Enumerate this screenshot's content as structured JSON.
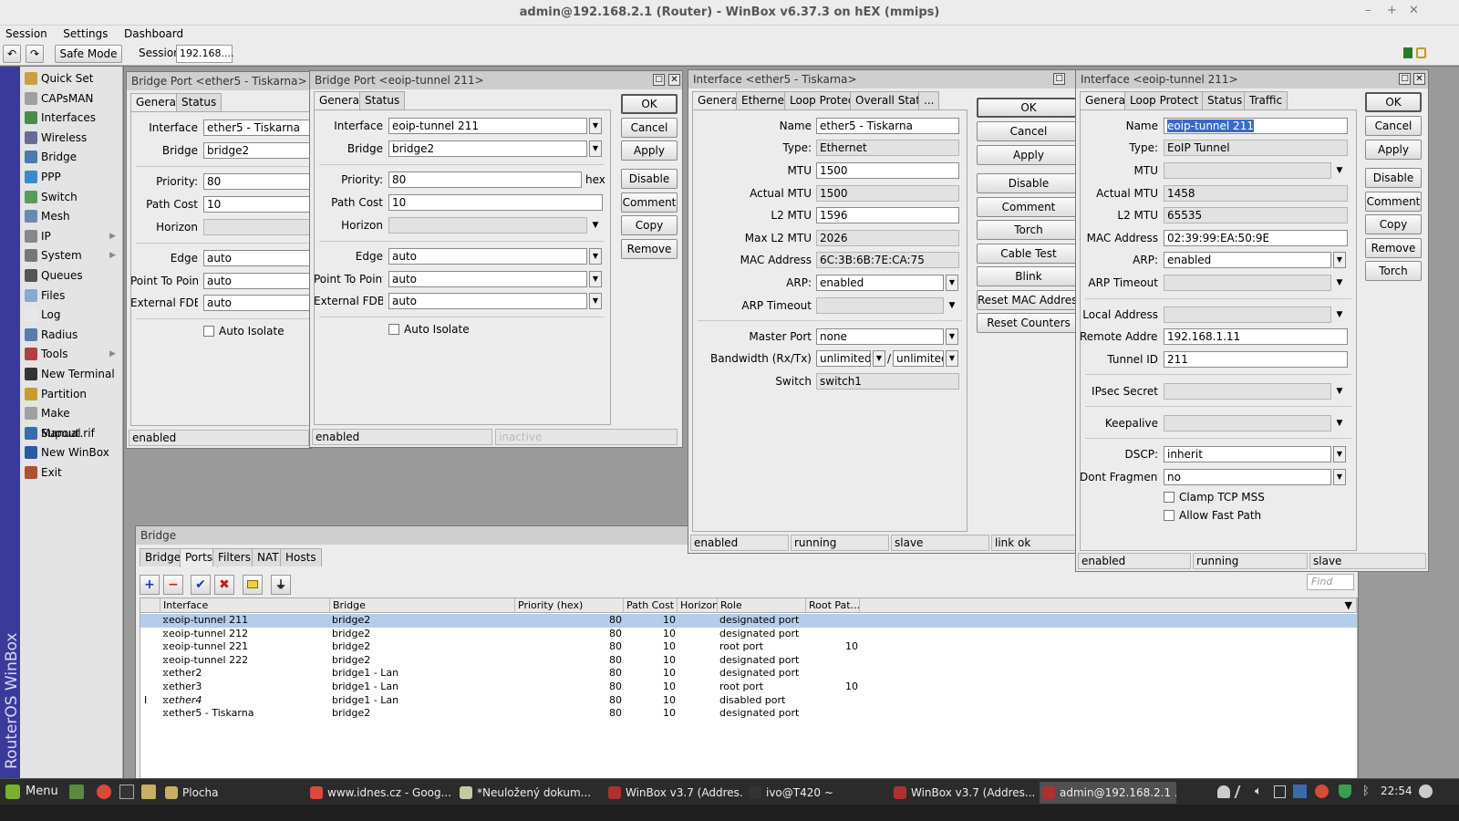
{
  "app": {
    "title": "admin@192.168.2.1 (Router) - WinBox v6.37.3 on hEX (mmips)",
    "menu": [
      "Session",
      "Settings",
      "Dashboard"
    ],
    "toolbar": {
      "safe_mode": "Safe Mode",
      "session_label": "Session",
      "session_value": "192.168...."
    },
    "vertical_brand": "RouterOS WinBox"
  },
  "sidebar": {
    "items": [
      {
        "label": "Quick Set",
        "icon": "quick-set-icon",
        "color": "#c8a040"
      },
      {
        "label": "CAPsMAN",
        "icon": "capsman-icon",
        "color": "#a0a0a0"
      },
      {
        "label": "Interfaces",
        "icon": "interfaces-icon",
        "color": "#4a8a4a"
      },
      {
        "label": "Wireless",
        "icon": "wireless-icon",
        "color": "#6a6a9a"
      },
      {
        "label": "Bridge",
        "icon": "bridge-icon",
        "color": "#4a7ab0"
      },
      {
        "label": "PPP",
        "icon": "ppp-icon",
        "color": "#3a8acd"
      },
      {
        "label": "Switch",
        "icon": "switch-icon",
        "color": "#5a9a5a"
      },
      {
        "label": "Mesh",
        "icon": "mesh-icon",
        "color": "#6a8ab0"
      },
      {
        "label": "IP",
        "icon": "ip-icon",
        "color": "#888888",
        "sub": true
      },
      {
        "label": "System",
        "icon": "system-icon",
        "color": "#777777",
        "sub": true
      },
      {
        "label": "Queues",
        "icon": "queues-icon",
        "color": "#555555"
      },
      {
        "label": "Files",
        "icon": "files-icon",
        "color": "#8aa8d0"
      },
      {
        "label": "Log",
        "icon": "log-icon",
        "color": "#e8e8e8"
      },
      {
        "label": "Radius",
        "icon": "radius-icon",
        "color": "#5a7ab0"
      },
      {
        "label": "Tools",
        "icon": "tools-icon",
        "color": "#b04040",
        "sub": true
      },
      {
        "label": "New Terminal",
        "icon": "terminal-icon",
        "color": "#333333"
      },
      {
        "label": "Partition",
        "icon": "partition-icon",
        "color": "#c89a30"
      },
      {
        "label": "Make Supout.rif",
        "icon": "supout-icon",
        "color": "#a0a0a0"
      },
      {
        "label": "Manual",
        "icon": "manual-icon",
        "color": "#3a6ab0"
      },
      {
        "label": "New WinBox",
        "icon": "winbox-icon",
        "color": "#2a5aa0"
      },
      {
        "label": "Exit",
        "icon": "exit-icon",
        "color": "#b05030"
      }
    ]
  },
  "bp1": {
    "title": "Bridge Port <ether5 - Tiskarna>",
    "tabs": [
      "General",
      "Status"
    ],
    "labels": {
      "interface": "Interface",
      "bridge": "Bridge",
      "priority": "Priority:",
      "path_cost": "Path Cost",
      "horizon": "Horizon",
      "edge": "Edge",
      "p2p": "Point To Point",
      "ext_fdb": "External FDB",
      "auto_isolate": "Auto Isolate"
    },
    "values": {
      "interface": "ether5 - Tiskarna",
      "bridge": "bridge2",
      "priority": "80",
      "path_cost": "10",
      "horizon": "",
      "edge": "auto",
      "p2p": "auto",
      "ext_fdb": "auto"
    },
    "status": "enabled"
  },
  "bp2": {
    "title": "Bridge Port <eoip-tunnel 211>",
    "tabs": [
      "General",
      "Status"
    ],
    "labels": {
      "interface": "Interface",
      "bridge": "Bridge",
      "priority": "Priority:",
      "path_cost": "Path Cost",
      "horizon": "Horizon",
      "edge": "Edge",
      "p2p": "Point To Point",
      "ext_fdb": "External FDB",
      "auto_isolate": "Auto Isolate",
      "hex": "hex"
    },
    "values": {
      "interface": "eoip-tunnel 211",
      "bridge": "bridge2",
      "priority": "80",
      "path_cost": "10",
      "horizon": "",
      "edge": "auto",
      "p2p": "auto",
      "ext_fdb": "auto"
    },
    "buttons": [
      "OK",
      "Cancel",
      "Apply",
      "Disable",
      "Comment",
      "Copy",
      "Remove"
    ],
    "status": [
      "enabled",
      "inactive"
    ]
  },
  "if1": {
    "title": "Interface <ether5 - Tiskarna>",
    "tabs": [
      "General",
      "Ethernet",
      "Loop Protect",
      "Overall Stats",
      "..."
    ],
    "labels": {
      "name": "Name",
      "type": "Type:",
      "mtu": "MTU",
      "actual_mtu": "Actual MTU",
      "l2mtu": "L2 MTU",
      "max_l2mtu": "Max L2 MTU",
      "mac": "MAC Address",
      "arp": "ARP:",
      "arp_timeout": "ARP Timeout",
      "master_port": "Master Port",
      "bandwidth": "Bandwidth (Rx/Tx)",
      "switch": "Switch",
      "slash": "/"
    },
    "values": {
      "name": "ether5 - Tiskarna",
      "type": "Ethernet",
      "mtu": "1500",
      "actual_mtu": "1500",
      "l2mtu": "1596",
      "max_l2mtu": "2026",
      "mac": "6C:3B:6B:7E:CA:75",
      "arp": "enabled",
      "arp_timeout": "",
      "master_port": "none",
      "bw_rx": "unlimited",
      "bw_tx": "unlimited",
      "switch": "switch1"
    },
    "buttons": [
      "OK",
      "Cancel",
      "Apply",
      "Disable",
      "Comment",
      "Torch",
      "Cable Test",
      "Blink",
      "Reset MAC Address",
      "Reset Counters"
    ],
    "status": [
      "enabled",
      "running",
      "slave",
      "link ok"
    ]
  },
  "if2": {
    "title": "Interface <eoip-tunnel 211>",
    "tabs": [
      "General",
      "Loop Protect",
      "Status",
      "Traffic"
    ],
    "labels": {
      "name": "Name",
      "type": "Type:",
      "mtu": "MTU",
      "actual_mtu": "Actual MTU",
      "l2mtu": "L2 MTU",
      "mac": "MAC Address",
      "arp": "ARP:",
      "arp_timeout": "ARP Timeout",
      "local": "Local Address",
      "remote": "Remote Address",
      "tunnel_id": "Tunnel ID",
      "ipsec": "IPsec Secret",
      "keepalive": "Keepalive",
      "dscp": "DSCP:",
      "dont_frag": "Dont Fragment",
      "clamp": "Clamp TCP MSS",
      "fast_path": "Allow Fast Path"
    },
    "values": {
      "name": "eoip-tunnel 211",
      "type": "EoIP Tunnel",
      "mtu": "",
      "actual_mtu": "1458",
      "l2mtu": "65535",
      "mac": "02:39:99:EA:50:9E",
      "arp": "enabled",
      "arp_timeout": "",
      "local": "",
      "remote": "192.168.1.11",
      "tunnel_id": "211",
      "ipsec": "",
      "keepalive": "",
      "dscp": "inherit",
      "dont_frag": "no"
    },
    "buttons": [
      "OK",
      "Cancel",
      "Apply",
      "Disable",
      "Comment",
      "Copy",
      "Remove",
      "Torch"
    ],
    "status": [
      "enabled",
      "running",
      "slave"
    ]
  },
  "bridge": {
    "title": "Bridge",
    "tabs": [
      "Bridge",
      "Ports",
      "Filters",
      "NAT",
      "Hosts"
    ],
    "find_placeholder": "Find",
    "columns": [
      "Interface",
      "Bridge",
      "Priority (hex)",
      "Path Cost",
      "Horizon",
      "Role",
      "Root Pat..."
    ],
    "rows": [
      {
        "flag": "",
        "iface": "eoip-tunnel 211",
        "bridge": "bridge2",
        "priority": "80",
        "cost": "10",
        "horizon": "",
        "role": "designated port",
        "root": "",
        "selected": true,
        "italic": false
      },
      {
        "flag": "",
        "iface": "eoip-tunnel 212",
        "bridge": "bridge2",
        "priority": "80",
        "cost": "10",
        "horizon": "",
        "role": "designated port",
        "root": "",
        "selected": false,
        "italic": false
      },
      {
        "flag": "",
        "iface": "eoip-tunnel 221",
        "bridge": "bridge2",
        "priority": "80",
        "cost": "10",
        "horizon": "",
        "role": "root port",
        "root": "10",
        "selected": false,
        "italic": false
      },
      {
        "flag": "",
        "iface": "eoip-tunnel 222",
        "bridge": "bridge2",
        "priority": "80",
        "cost": "10",
        "horizon": "",
        "role": "designated port",
        "root": "",
        "selected": false,
        "italic": false
      },
      {
        "flag": "",
        "iface": "ether2",
        "bridge": "bridge1 - Lan",
        "priority": "80",
        "cost": "10",
        "horizon": "",
        "role": "designated port",
        "root": "",
        "selected": false,
        "italic": false
      },
      {
        "flag": "",
        "iface": "ether3",
        "bridge": "bridge1 - Lan",
        "priority": "80",
        "cost": "10",
        "horizon": "",
        "role": "root port",
        "root": "10",
        "selected": false,
        "italic": false
      },
      {
        "flag": "I",
        "iface": "ether4",
        "bridge": "bridge1 - Lan",
        "priority": "80",
        "cost": "10",
        "horizon": "",
        "role": "disabled port",
        "root": "",
        "selected": false,
        "italic": true
      },
      {
        "flag": "",
        "iface": "ether5 - Tiskarna",
        "bridge": "bridge2",
        "priority": "80",
        "cost": "10",
        "horizon": "",
        "role": "designated port",
        "root": "",
        "selected": false,
        "italic": false
      }
    ]
  },
  "taskbar": {
    "menu": "Menu",
    "tasks": [
      {
        "label": "Plocha",
        "icon": "folder-icon",
        "color": "#c8b060"
      },
      {
        "label": "www.idnes.cz - Goog...",
        "icon": "chrome-icon",
        "color": "#d84a3a"
      },
      {
        "label": "*Neuložený dokum...",
        "icon": "text-editor-icon",
        "color": "#c8c8a0"
      },
      {
        "label": "WinBox v3.7 (Addres...",
        "icon": "winbox-task-icon",
        "color": "#b03030"
      },
      {
        "label": "ivo@T420 ~",
        "icon": "terminal-task-icon",
        "color": "#333333"
      },
      {
        "label": "WinBox v3.7 (Addres...",
        "icon": "winbox-task-icon",
        "color": "#b03030"
      },
      {
        "label": "admin@192.168.2.1 ...",
        "icon": "winbox-task-icon",
        "color": "#b03030"
      }
    ],
    "clock": "22:54"
  }
}
